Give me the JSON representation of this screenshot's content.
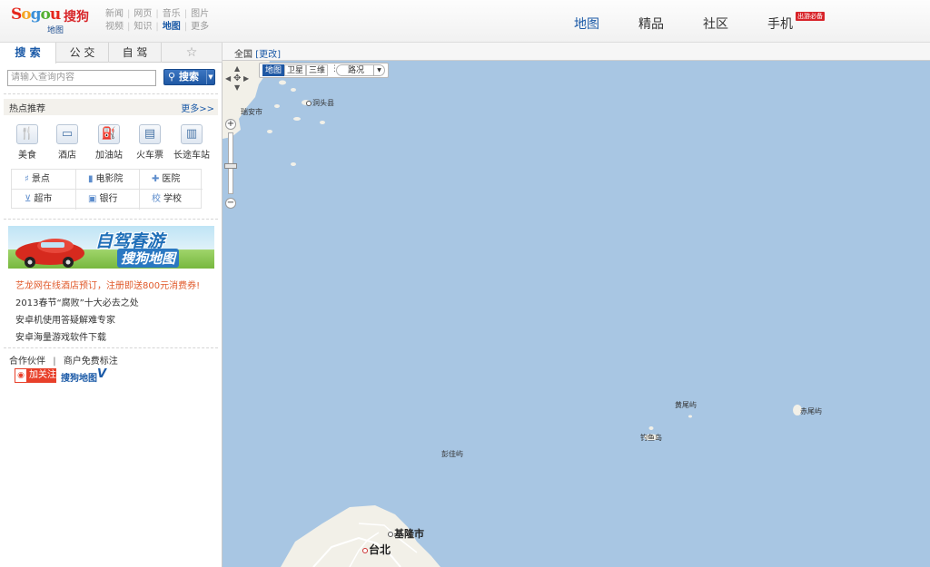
{
  "header": {
    "logo_word": [
      "S",
      "o",
      "g",
      "o",
      "u"
    ],
    "logo_cn": "搜狗",
    "logo_sub": "地图",
    "channels_row1": [
      "新闻",
      "网页",
      "音乐",
      "图片"
    ],
    "channels_row2": [
      "视频",
      "知识",
      "地图",
      "更多"
    ],
    "nav": [
      "地图",
      "精品",
      "社区",
      "手机"
    ],
    "badge": "出游必备"
  },
  "left": {
    "tabs": [
      "搜 索",
      "公 交",
      "自 驾",
      "☆"
    ],
    "search_placeholder": "请输入查询内容",
    "search_button": "搜索",
    "hot_title": "热点推荐",
    "more": "更多>>",
    "poi": [
      {
        "label": "美食",
        "icon": "fork-knife-icon",
        "glyph": "🍴"
      },
      {
        "label": "酒店",
        "icon": "bed-icon",
        "glyph": "▭"
      },
      {
        "label": "加油站",
        "icon": "fuel-pump-icon",
        "glyph": "⛽"
      },
      {
        "label": "火车票",
        "icon": "ticket-icon",
        "glyph": "▤"
      },
      {
        "label": "长途车站",
        "icon": "bus-icon",
        "glyph": "▥"
      }
    ],
    "categories": [
      {
        "label": "景点",
        "icon": "landmark-icon",
        "glyph": "♯"
      },
      {
        "label": "电影院",
        "icon": "cinema-icon",
        "glyph": "▮"
      },
      {
        "label": "医院",
        "icon": "hospital-icon",
        "glyph": "✚"
      },
      {
        "label": "超市",
        "icon": "cart-icon",
        "glyph": "⊻"
      },
      {
        "label": "银行",
        "icon": "bank-icon",
        "glyph": "▣"
      },
      {
        "label": "学校",
        "icon": "school-icon",
        "glyph": "校"
      }
    ],
    "banner_title": "自驾春游",
    "banner_sub": "搜狗地图",
    "news": [
      "艺龙网在线酒店预订，注册即送800元消费券!",
      "2013春节“腐败”十大必去之处",
      "安卓机使用答疑解难专家",
      "安卓海量游戏软件下载"
    ],
    "footer_links": [
      "合作伙伴",
      "商户免费标注"
    ],
    "weibo_follow": "加关注",
    "weibo_name": "搜狗地图",
    "weibo_v": "V"
  },
  "map": {
    "region": "全国",
    "change": "[更改]",
    "types": [
      "地图",
      "卫星",
      "三维"
    ],
    "traffic": "路况",
    "places": [
      {
        "name": "洞头县",
        "dot": true
      },
      {
        "name": "瑞安市",
        "dot": false
      },
      {
        "name": "黄尾屿",
        "dot": false
      },
      {
        "name": "赤尾屿",
        "dot": false
      },
      {
        "name": "钓鱼岛",
        "dot": false
      },
      {
        "name": "彭佳屿",
        "dot": false
      },
      {
        "name": "基隆市",
        "dot": true
      },
      {
        "name": "台北",
        "dot": true
      }
    ],
    "colors": {
      "sea": "#a8c6e3",
      "land": "#f2f0e8",
      "road": "#ffffff"
    }
  }
}
